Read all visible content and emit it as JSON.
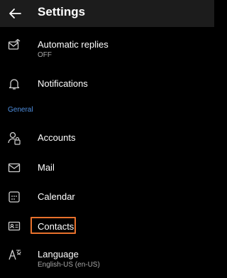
{
  "header": {
    "title": "Settings",
    "back_icon": "arrow-left-icon"
  },
  "items": [
    {
      "label": "Automatic replies",
      "sublabel": "OFF",
      "icon": "envelope-reply-icon"
    },
    {
      "label": "Notifications",
      "icon": "bell-icon"
    }
  ],
  "section": {
    "label": "General",
    "color": "#4f8fe0"
  },
  "general_items": [
    {
      "label": "Accounts",
      "icon": "person-lock-icon"
    },
    {
      "label": "Mail",
      "icon": "mail-icon"
    },
    {
      "label": "Calendar",
      "icon": "calendar-icon"
    },
    {
      "label": "Contacts",
      "icon": "contact-card-icon"
    },
    {
      "label": "Language",
      "sublabel": "English-US (en-US)",
      "icon": "language-icon"
    }
  ],
  "colors": {
    "background": "#000000",
    "appbar": "#1c1c1c",
    "highlight": "#e8712c"
  }
}
